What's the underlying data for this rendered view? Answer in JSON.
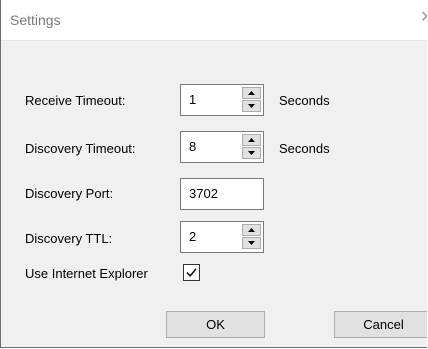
{
  "window": {
    "title": "Settings",
    "close_glyph": "✕"
  },
  "form": {
    "receive_timeout": {
      "label": "Receive Timeout:",
      "value": "1",
      "unit": "Seconds"
    },
    "discovery_timeout": {
      "label": "Discovery Timeout:",
      "value": "8",
      "unit": "Seconds"
    },
    "discovery_port": {
      "label": "Discovery Port:",
      "value": "3702"
    },
    "discovery_ttl": {
      "label": "Discovery TTL:",
      "value": "2"
    },
    "use_ie": {
      "label": "Use Internet Explorer",
      "checked": true
    }
  },
  "buttons": {
    "ok": "OK",
    "cancel": "Cancel"
  },
  "icons": [
    "close-icon",
    "spin-up-icon",
    "spin-down-icon",
    "checkmark-icon"
  ],
  "colors": {
    "dialog_bg": "#f0f0f0",
    "title_bg": "#ffffff",
    "button_bg": "#e1e1e1",
    "border": "#7a7a7a"
  }
}
